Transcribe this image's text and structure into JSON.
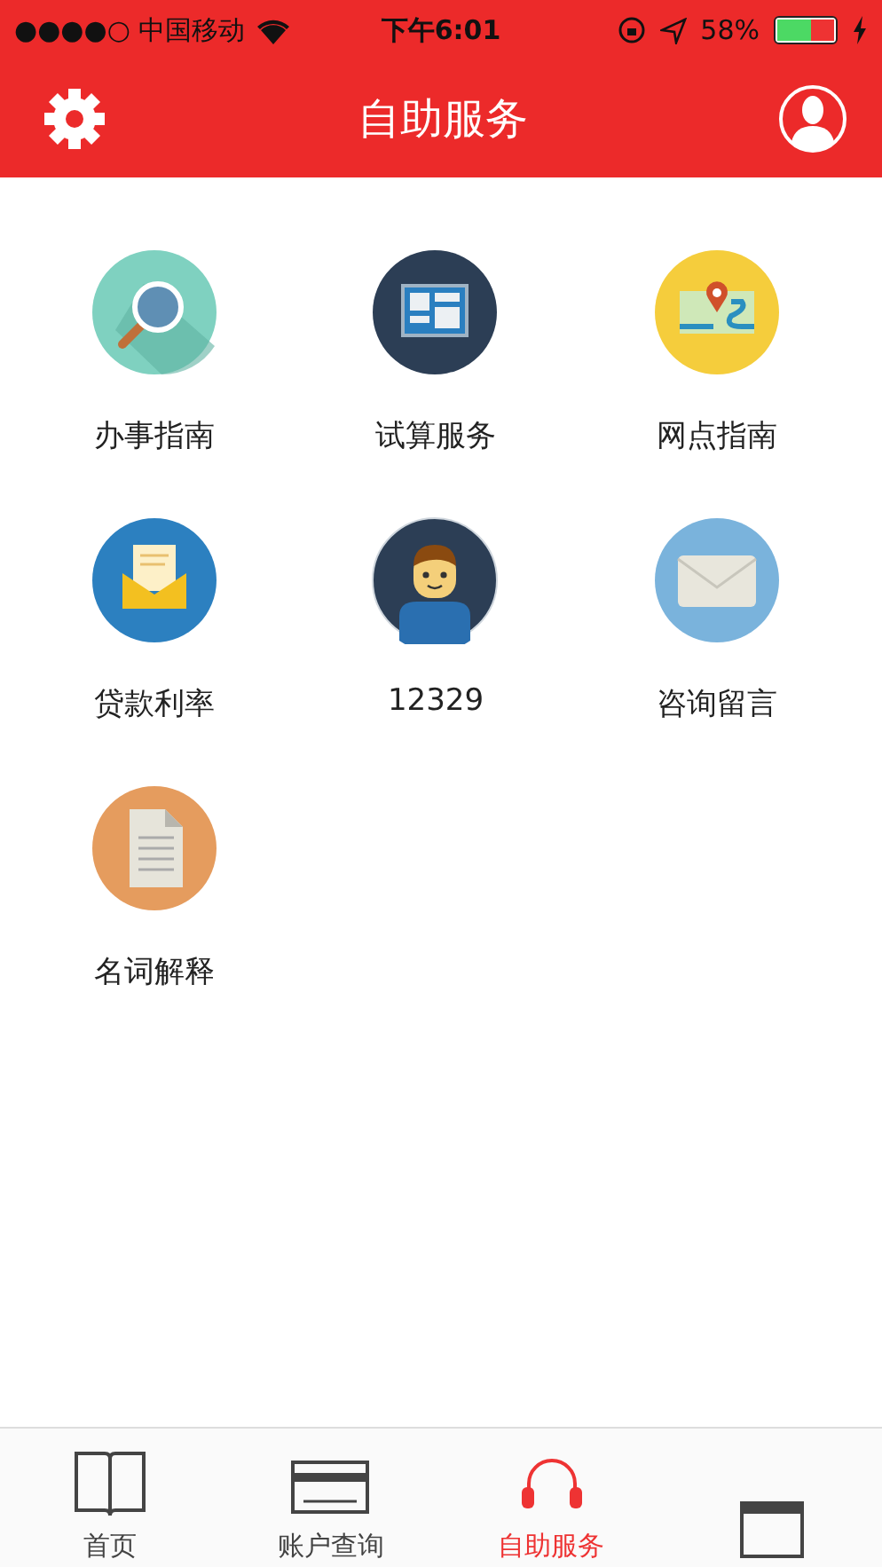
{
  "status_bar": {
    "carrier": "●●●●○ 中国移动",
    "time": "下午6:01",
    "battery": "58%"
  },
  "header": {
    "title": "自助服务"
  },
  "services": [
    {
      "label": "办事指南",
      "kind": "search"
    },
    {
      "label": "试算服务",
      "kind": "calculator"
    },
    {
      "label": "网点指南",
      "kind": "map"
    },
    {
      "label": "贷款利率",
      "kind": "letter"
    },
    {
      "label": "12329",
      "kind": "agent"
    },
    {
      "label": "咨询留言",
      "kind": "envelope"
    },
    {
      "label": "名词解释",
      "kind": "document"
    }
  ],
  "tabs": [
    {
      "label": "首页",
      "kind": "book",
      "selected": false
    },
    {
      "label": "账户查询",
      "kind": "card",
      "selected": false
    },
    {
      "label": "自助服务",
      "kind": "headset",
      "selected": true
    },
    {
      "kind": "calendar",
      "selected": false
    }
  ]
}
